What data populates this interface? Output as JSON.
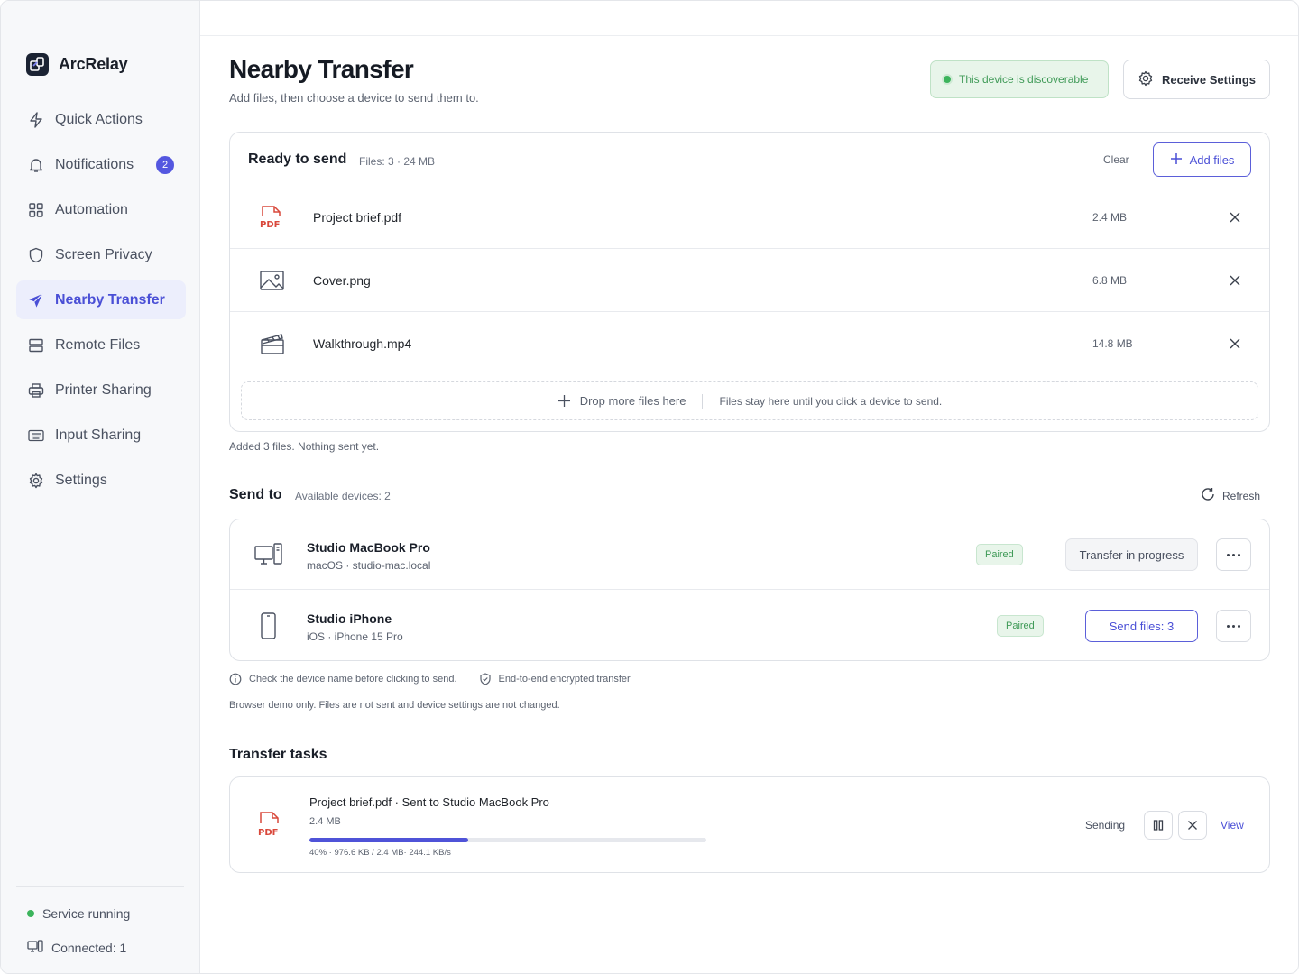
{
  "app": {
    "name": "ArcRelay"
  },
  "sidebar": {
    "items": [
      {
        "label": "Quick Actions",
        "icon": "lightning-icon"
      },
      {
        "label": "Notifications",
        "icon": "bell-icon",
        "badge": "2"
      },
      {
        "label": "Automation",
        "icon": "grid-icon"
      },
      {
        "label": "Screen Privacy",
        "icon": "shield-icon"
      },
      {
        "label": "Nearby Transfer",
        "icon": "send-icon",
        "active": true
      },
      {
        "label": "Remote Files",
        "icon": "server-icon"
      },
      {
        "label": "Printer Sharing",
        "icon": "printer-icon"
      },
      {
        "label": "Input Sharing",
        "icon": "keyboard-icon"
      },
      {
        "label": "Settings",
        "icon": "gear-icon"
      }
    ],
    "status": "Service running",
    "connected": "Connected: 1"
  },
  "header": {
    "title": "Nearby Transfer",
    "subtitle": "Add files, then choose a device to send them to.",
    "discoverable": "This device is discoverable",
    "receive_settings": "Receive Settings"
  },
  "ready": {
    "title": "Ready to send",
    "meta": "Files: 3 · 24 MB",
    "clear": "Clear",
    "add_files": "Add files",
    "files": [
      {
        "name": "Project brief.pdf",
        "size": "2.4 MB",
        "type": "pdf-file-icon"
      },
      {
        "name": "Cover.png",
        "size": "6.8 MB",
        "type": "image-file-icon"
      },
      {
        "name": "Walkthrough.mp4",
        "size": "14.8 MB",
        "type": "video-file-icon"
      }
    ],
    "drop_label": "Drop more files here",
    "drop_note": "Files stay here until you click a device to send.",
    "added_note": "Added 3 files. Nothing sent yet."
  },
  "send_to": {
    "title": "Send to",
    "meta": "Available devices: 2",
    "refresh": "Refresh",
    "devices": [
      {
        "name": "Studio MacBook Pro",
        "sub": "macOS · studio-mac.local",
        "status": "Paired",
        "action": "Transfer in progress"
      },
      {
        "name": "Studio iPhone",
        "sub": "iOS · iPhone 15 Pro",
        "status": "Paired",
        "action": "Send files: 3"
      }
    ],
    "hint_check": "Check the device name before clicking to send.",
    "hint_encrypted": "End-to-end encrypted transfer",
    "demo_note": "Browser demo only. Files are not sent and device settings are not changed."
  },
  "tasks": {
    "title": "Transfer tasks",
    "items": [
      {
        "title": "Project brief.pdf · Sent to Studio MacBook Pro",
        "size": "2.4 MB",
        "progress": 0.4,
        "stats": "40% · 976.6 KB / 2.4 MB· 244.1 KB/s",
        "state": "Sending",
        "view": "View"
      }
    ]
  },
  "colors": {
    "accent": "#4f53d8",
    "success": "#3cb45c",
    "pdf_red": "#d9483b"
  }
}
